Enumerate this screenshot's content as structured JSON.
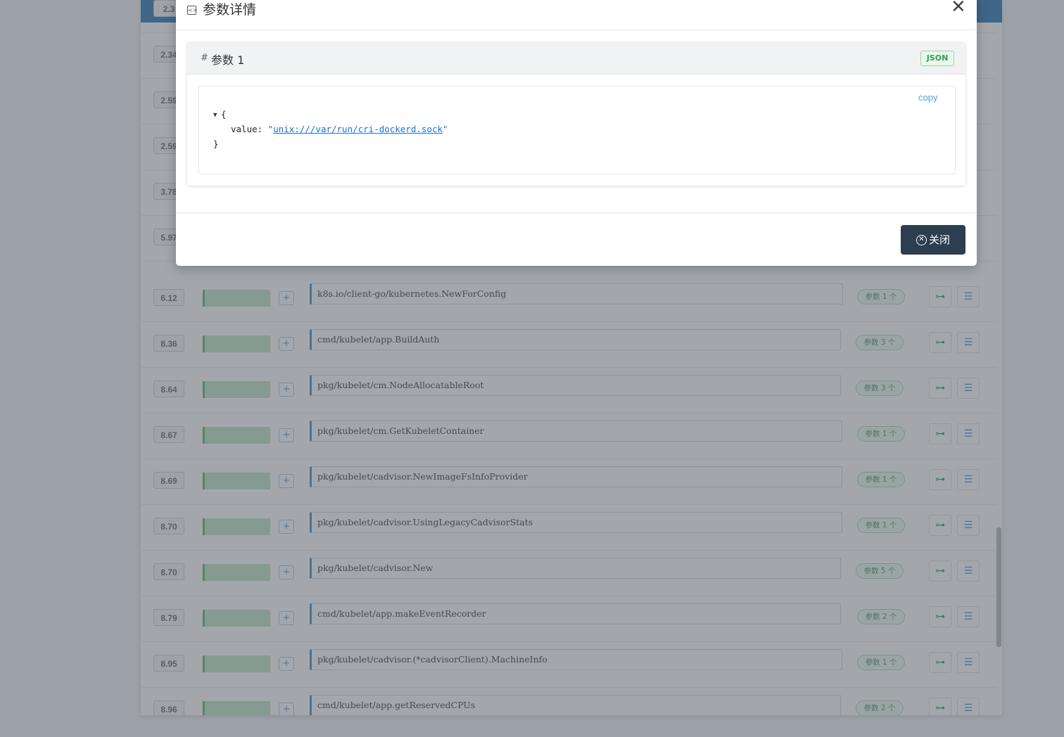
{
  "background": {
    "visible_partial_times": [
      "2.3",
      "2.34",
      "2.59",
      "2.59",
      "3.78",
      "5.97"
    ],
    "rows": [
      {
        "time": "6.12",
        "fill": 1.0,
        "func": "k8s.io/client-go/kubernetes.NewForConfig",
        "params": "参数 1 个"
      },
      {
        "time": "8.36",
        "fill": 1.0,
        "func": "cmd/kubelet/app.BuildAuth",
        "params": "参数 3 个"
      },
      {
        "time": "8.64",
        "fill": 1.0,
        "func": "pkg/kubelet/cm.NodeAllocatableRoot",
        "params": "参数 3 个"
      },
      {
        "time": "8.67",
        "fill": 1.0,
        "func": "pkg/kubelet/cm.GetKubeletContainer",
        "params": "参数 1 个"
      },
      {
        "time": "8.69",
        "fill": 1.0,
        "func": "pkg/kubelet/cadvisor.NewImageFsInfoProvider",
        "params": "参数 1 个"
      },
      {
        "time": "8.70",
        "fill": 1.0,
        "func": "pkg/kubelet/cadvisor.UsingLegacyCadvisorStats",
        "params": "参数 1 个"
      },
      {
        "time": "8.70",
        "fill": 1.0,
        "func": "pkg/kubelet/cadvisor.New",
        "params": "参数 5 个"
      },
      {
        "time": "8.79",
        "fill": 1.0,
        "func": "cmd/kubelet/app.makeEventRecorder",
        "params": "参数 2 个"
      },
      {
        "time": "8.95",
        "fill": 1.0,
        "func": "pkg/kubelet/cadvisor.(*cadvisorClient).MachineInfo",
        "params": "参数 1 个"
      },
      {
        "time": "8.96",
        "fill": 1.0,
        "func": "cmd/kubelet/app.getReservedCPUs",
        "params": "参数 2 个"
      }
    ]
  },
  "modal": {
    "title": "参数详情",
    "close_icon": "close-icon",
    "param": {
      "hash": "#",
      "name": "参数 1",
      "tag": "JSON",
      "copy_label": "copy",
      "json_open": "{",
      "json_key": "value:",
      "json_value": "unix:///var/run/cri-dockerd.sock",
      "json_close": "}"
    },
    "footer_close_label": "关闭"
  },
  "colors": {
    "overlay": "#606870",
    "header_blue": "#1565a8",
    "close_button": "#2c3e50",
    "green_accent": "#4caf50",
    "link_blue": "#1a6fd1"
  }
}
